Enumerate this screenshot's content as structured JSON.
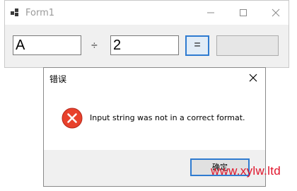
{
  "window": {
    "title": "Form1",
    "icon": "app-icon",
    "controls": [
      "minimize-icon",
      "maximize-icon",
      "close-icon"
    ]
  },
  "calculator": {
    "operand_a": "A",
    "operator": "÷",
    "operand_b": "2",
    "equals_label": "=",
    "result": ""
  },
  "dialog": {
    "title": "错误",
    "icon": "error-icon",
    "message": "Input string was not in a correct format.",
    "ok_label": "确定"
  },
  "watermark": "www.xylw.ltd",
  "colors": {
    "accent_border": "#2f7bd0",
    "error_red": "#e8412c",
    "watermark_red": "#e0142b"
  }
}
